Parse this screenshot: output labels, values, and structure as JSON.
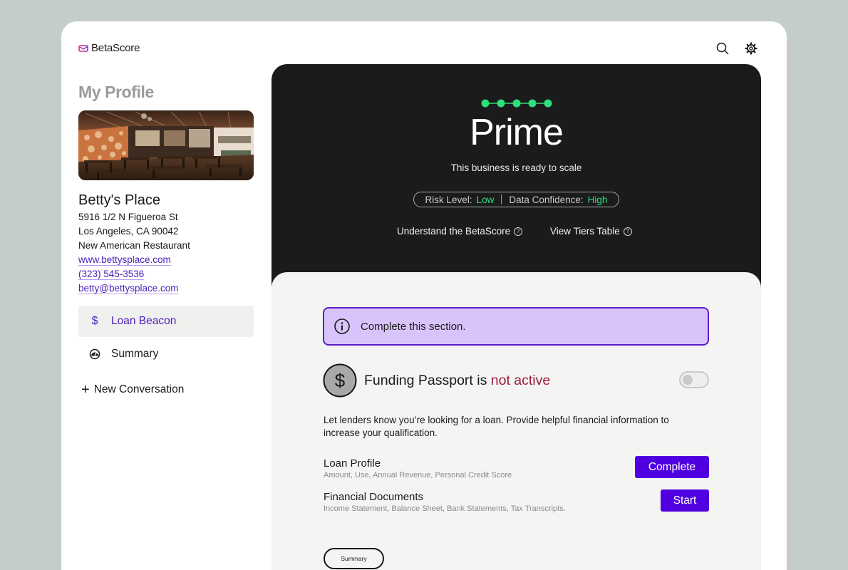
{
  "app": {
    "brand_name": "BetaScore"
  },
  "sidebar": {
    "title": "My Profile",
    "business": {
      "name": "Betty's Place",
      "address_line1": "5916 1/2 N Figueroa St",
      "address_line2": "Los Angeles, CA 90042",
      "category": "New American Restaurant",
      "website": "www.bettysplace.com",
      "phone": "(323) 545-3536",
      "email": "betty@bettysplace.com"
    },
    "nav": [
      {
        "label": "Loan Beacon",
        "icon": "dollar-icon",
        "active": true
      },
      {
        "label": "Summary",
        "icon": "gauge-icon",
        "active": false
      }
    ],
    "new_conversation": "New Conversation"
  },
  "hero": {
    "tier": "Prime",
    "tagline": "This business is ready to scale",
    "risk_label": "Risk Level:",
    "risk_value": "Low",
    "confidence_label": "Data Confidence:",
    "confidence_value": "High",
    "link_understand": "Understand the BetaScore",
    "link_tiers": "View Tiers Table",
    "dots_filled": 5
  },
  "panel": {
    "alert_text": "Complete this section.",
    "passport_prefix": "Funding Passport is",
    "passport_status": "not active",
    "toggle_on": false,
    "description": "Let lenders know you’re looking for a loan. Provide helpful financial information to increase your qualification.",
    "tasks": [
      {
        "title": "Loan Profile",
        "subtitle": "Amount, Use, Annual Revenue, Personal Credit Score",
        "action": "Complete"
      },
      {
        "title": "Financial Documents",
        "subtitle": "Income Statement, Balance Sheet, Bank Statements, Tax Transcripts.",
        "action": "Start"
      }
    ],
    "summary_button": "Summary"
  },
  "colors": {
    "accent": "#5000e0",
    "score_green": "#2fe07a",
    "status_red": "#9e1b44",
    "alert_bg": "#d9c3fb"
  }
}
